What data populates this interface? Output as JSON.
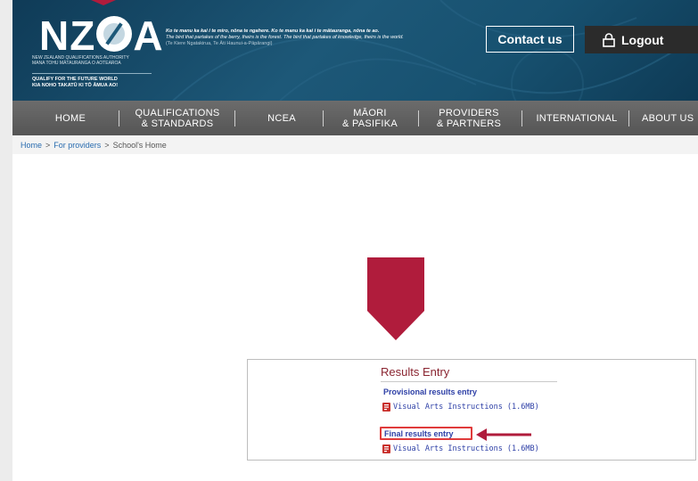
{
  "colors": {
    "header_bg": "#1d5878",
    "nav_bg": "#5e5e5e",
    "accent_red": "#b01c3c",
    "link_blue": "#2d3fa6",
    "card_title": "#8a2531",
    "highlight_box": "#e03b3b"
  },
  "header": {
    "logo": {
      "wordmark": "NZQA",
      "authority_lines": [
        "NEW ZEALAND QUALIFICATIONS AUTHORITY",
        "MANA TOHU MĀTAURANGA O AOTEAROA"
      ],
      "tagline_lines": [
        "QUALIFY FOR THE FUTURE WORLD",
        "KIA NOHO TAKATŪ KI TŌ ĀMUA AO!"
      ]
    },
    "proverb": {
      "maori": "Ko te manu ka kai i te miro, nōna te ngahere. Ko te manu ka kai i te mātauranga, nōna te ao.",
      "english": "The bird that partakes of the berry, theirs is the forest. The bird that partakes of knowledge, theirs is the world.",
      "attribution": "(Te Kiere Ngatakirua, Te Āti Haunui-a-Pāpārangi)"
    },
    "contact_label": "Contact us",
    "logout_label": "Logout",
    "logout_icon": "lock-icon"
  },
  "nav": {
    "items": [
      {
        "line1": "HOME",
        "line2": ""
      },
      {
        "line1": "QUALIFICATIONS",
        "line2": "& STANDARDS"
      },
      {
        "line1": "NCEA",
        "line2": ""
      },
      {
        "line1": "MĀORI",
        "line2": "& PASIFIKA"
      },
      {
        "line1": "PROVIDERS",
        "line2": "& PARTNERS"
      },
      {
        "line1": "INTERNATIONAL",
        "line2": ""
      },
      {
        "line1": "ABOUT US",
        "line2": ""
      }
    ]
  },
  "breadcrumb": {
    "items": [
      "Home",
      "For providers",
      "School's Home"
    ],
    "separator": ">"
  },
  "results_card": {
    "title": "Results Entry",
    "provisional_label": "Provisional results entry",
    "provisional_doc": "Visual Arts Instructions (1.6MB)",
    "final_label": "Final results entry",
    "final_doc": "Visual Arts Instructions (1.6MB)",
    "doc_icon": "pdf-icon"
  }
}
